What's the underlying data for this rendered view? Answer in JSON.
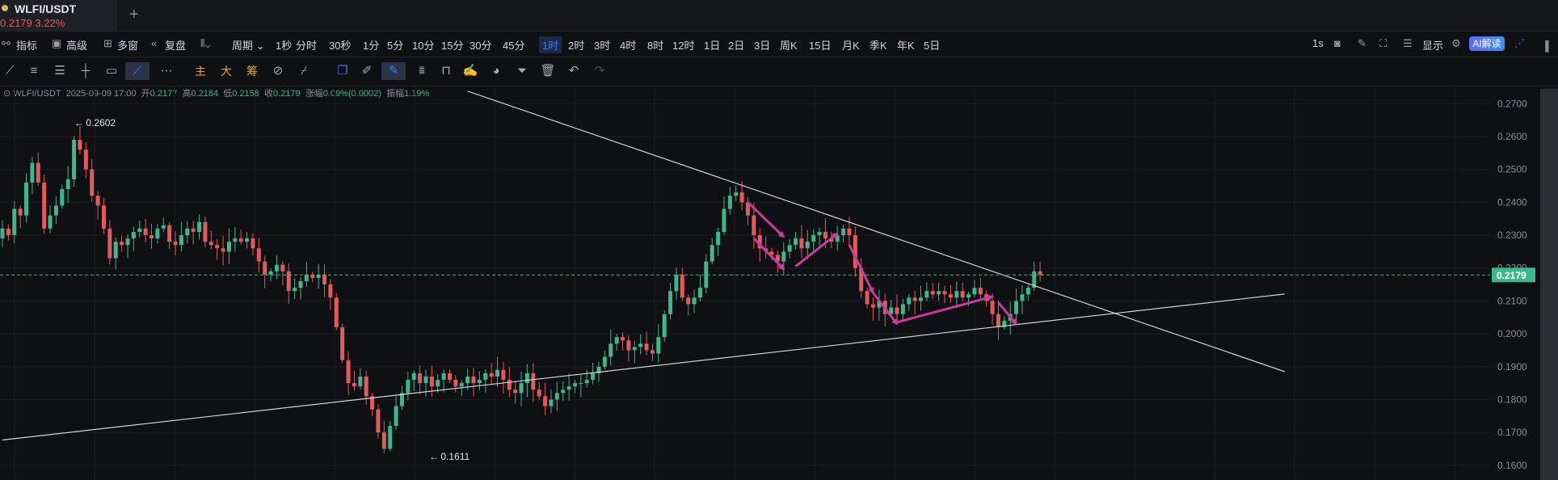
{
  "tab": {
    "symbol": "WLFI/USDT",
    "price": "0.2179",
    "change": "3.22%"
  },
  "toolbar": {
    "indicators_label": "指标",
    "advanced_label": "高级",
    "multiwindow_label": "多窗",
    "replay_label": "复盘",
    "period_label": "周期",
    "intervals": [
      "1秒",
      "分时",
      "30秒",
      "1分",
      "5分",
      "10分",
      "15分",
      "30分",
      "45分",
      "1时",
      "2时",
      "3时",
      "4时",
      "8时",
      "12时",
      "1日",
      "2日",
      "3日",
      "周K",
      "15日",
      "月K",
      "季K",
      "年K",
      "5日"
    ],
    "selected_interval": "1时",
    "right_1s": "1s",
    "display_label": "显示",
    "ai_label": "AI解读"
  },
  "drawing_tools": {
    "main_label": "主",
    "big_label": "大",
    "chip_label": "筹"
  },
  "ohlc": {
    "symbol": "WLFI/USDT",
    "time": "2025-09-09 17:00",
    "open_label": "开",
    "open": "0.2177",
    "high_label": "高",
    "high": "0.2184",
    "low_label": "低",
    "low": "0.2158",
    "close_label": "收",
    "close": "0.2179",
    "change_label": "涨幅",
    "change": "0.09%(0.0002)",
    "amp_label": "振幅",
    "amp": "1.19%"
  },
  "chart_data": {
    "type": "candlestick",
    "y_axis_ticks": [
      "0.2700",
      "0.2600",
      "0.2500",
      "0.2400",
      "0.2300",
      "0.2200",
      "0.2100",
      "0.2000",
      "0.1900",
      "0.1800",
      "0.1700",
      "0.1600"
    ],
    "ylim": [
      0.1575,
      0.274
    ],
    "current_price_label": "0.2179",
    "current_price": 0.2179,
    "high_marker": "0.2602",
    "low_marker": "0.1611",
    "colors": {
      "up": "#3fb68b",
      "down": "#e35a5a",
      "trendline": "#cfd2d8",
      "annotation": "#c93a9b",
      "price_line": "#3fb68b"
    },
    "trendlines": [
      {
        "name": "descending",
        "from": [
          78,
          0.2738
        ],
        "to": [
          215,
          0.1885
        ]
      },
      {
        "name": "ascending",
        "from": [
          0,
          0.1677
        ],
        "to": [
          215,
          0.2121
        ]
      }
    ],
    "annotation_arrows": [
      {
        "from": [
          125,
          0.24
        ],
        "to": [
          131,
          0.2295
        ]
      },
      {
        "from": [
          126,
          0.229
        ],
        "to": [
          131,
          0.2197
        ]
      },
      {
        "from": [
          133,
          0.2205
        ],
        "to": [
          140,
          0.2305
        ]
      },
      {
        "from": [
          142,
          0.227
        ],
        "to": [
          146,
          0.2125
        ]
      },
      {
        "from": [
          146,
          0.2125
        ],
        "to": [
          150,
          0.203
        ]
      },
      {
        "from": [
          150,
          0.2035
        ],
        "to": [
          166,
          0.2113
        ]
      },
      {
        "from": [
          167,
          0.2095
        ],
        "to": [
          170,
          0.203
        ]
      }
    ],
    "close": [
      0.232,
      0.23,
      0.238,
      0.236,
      0.246,
      0.252,
      0.246,
      0.232,
      0.236,
      0.239,
      0.244,
      0.247,
      0.259,
      0.256,
      0.25,
      0.242,
      0.239,
      0.232,
      0.223,
      0.228,
      0.227,
      0.229,
      0.231,
      0.232,
      0.23,
      0.229,
      0.232,
      0.233,
      0.228,
      0.227,
      0.23,
      0.232,
      0.231,
      0.234,
      0.228,
      0.227,
      0.226,
      0.225,
      0.228,
      0.229,
      0.228,
      0.229,
      0.226,
      0.222,
      0.218,
      0.219,
      0.221,
      0.219,
      0.213,
      0.214,
      0.216,
      0.218,
      0.217,
      0.218,
      0.215,
      0.211,
      0.202,
      0.192,
      0.185,
      0.184,
      0.187,
      0.181,
      0.177,
      0.17,
      0.165,
      0.172,
      0.178,
      0.182,
      0.186,
      0.188,
      0.185,
      0.187,
      0.184,
      0.186,
      0.188,
      0.186,
      0.184,
      0.185,
      0.187,
      0.185,
      0.186,
      0.188,
      0.187,
      0.189,
      0.186,
      0.183,
      0.182,
      0.185,
      0.188,
      0.183,
      0.181,
      0.178,
      0.18,
      0.182,
      0.183,
      0.184,
      0.185,
      0.185,
      0.186,
      0.188,
      0.19,
      0.193,
      0.197,
      0.199,
      0.198,
      0.195,
      0.196,
      0.197,
      0.195,
      0.194,
      0.199,
      0.206,
      0.213,
      0.218,
      0.211,
      0.209,
      0.211,
      0.214,
      0.222,
      0.227,
      0.231,
      0.238,
      0.242,
      0.243,
      0.24,
      0.236,
      0.23,
      0.226,
      0.225,
      0.224,
      0.222,
      0.225,
      0.227,
      0.229,
      0.226,
      0.228,
      0.23,
      0.231,
      0.229,
      0.228,
      0.23,
      0.232,
      0.23,
      0.22,
      0.213,
      0.209,
      0.208,
      0.21,
      0.206,
      0.208,
      0.206,
      0.209,
      0.211,
      0.21,
      0.211,
      0.213,
      0.212,
      0.213,
      0.212,
      0.211,
      0.213,
      0.211,
      0.212,
      0.214,
      0.212,
      0.21,
      0.206,
      0.202,
      0.204,
      0.206,
      0.21,
      0.212,
      0.214,
      0.219,
      0.218
    ]
  }
}
